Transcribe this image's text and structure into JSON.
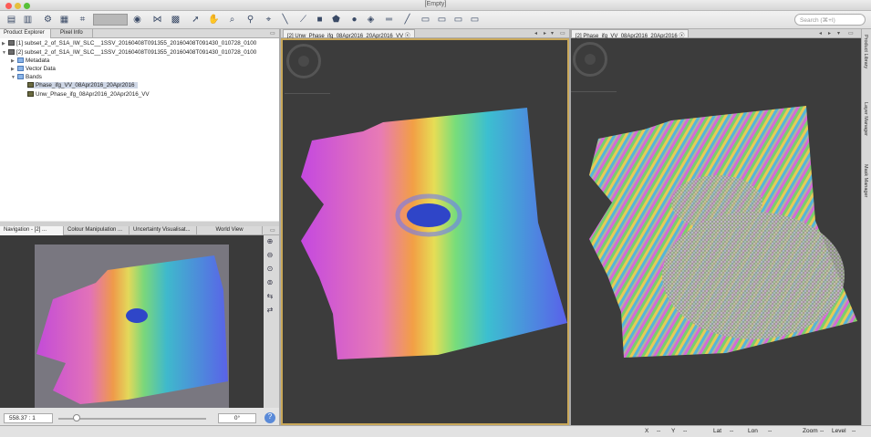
{
  "window": {
    "title": "[Empty]"
  },
  "search": {
    "placeholder": "Search (⌘+I)"
  },
  "product_explorer": {
    "tabs": [
      "Product Explorer",
      "Pixel Info"
    ],
    "products": [
      "[1] subset_2_of_S1A_IW_SLC__1SSV_20160408T091355_20160408T091430_010728_0100",
      "[2] subset_2_of_S1A_IW_SLC__1SSV_20160408T091355_20160408T091430_010728_0100"
    ],
    "folders": [
      "Metadata",
      "Vector Data",
      "Bands"
    ],
    "bands": [
      "Phase_ifg_VV_08Apr2016_20Apr2016",
      "Unw_Phase_ifg_08Apr2016_20Apr2016_VV"
    ]
  },
  "lower_tabs": [
    "Navigation - [2] ...",
    "Colour Manipulation ...",
    "Uncertainty Visualisat...",
    "World View"
  ],
  "navigation": {
    "scale": "558.37 : 1",
    "angle": "0°"
  },
  "view1": {
    "tab_label": "[2] Unw_Phase_ifg_08Apr2016_20Apr2016_VV"
  },
  "view2": {
    "tab_label": "[2] Phase_ifg_VV_08Apr2016_20Apr2016"
  },
  "right_sidebar": [
    "Product Library",
    "Layer Manager",
    "Mask Manager"
  ],
  "status": {
    "x_label": "X",
    "x_value": "--",
    "y_label": "Y",
    "y_value": "--",
    "lat_label": "Lat",
    "lat_value": "--",
    "lon_label": "Lon",
    "lon_value": "--",
    "zoom_label": "Zoom",
    "zoom_value": "--",
    "level_label": "Level",
    "level_value": "--"
  }
}
